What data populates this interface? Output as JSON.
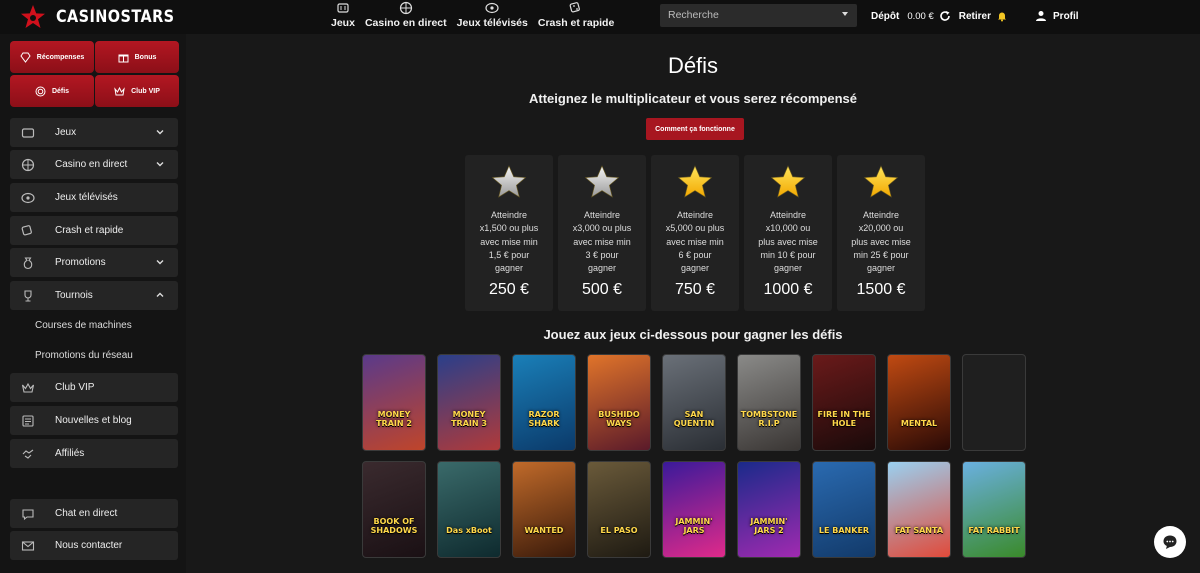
{
  "brand": {
    "name": "CASINOSTARS"
  },
  "topnav": [
    {
      "label": "Jeux",
      "icon": "slot-machine-icon"
    },
    {
      "label": "Casino en direct",
      "icon": "roulette-icon"
    },
    {
      "label": "Jeux télévisés",
      "icon": "tv-wheel-icon"
    },
    {
      "label": "Crash et rapide",
      "icon": "dice-icon"
    }
  ],
  "search": {
    "placeholder": "Recherche"
  },
  "account": {
    "deposit_label": "Dépôt",
    "balance": "0.00 €",
    "withdraw_label": "Retirer",
    "profile_label": "Profil"
  },
  "sidebar": {
    "promo_buttons": [
      {
        "label": "Récompenses",
        "icon": "diamond-icon"
      },
      {
        "label": "Bonus",
        "icon": "gift-icon"
      },
      {
        "label": "Défis",
        "icon": "target-icon"
      },
      {
        "label": "Club VIP",
        "icon": "crown-icon"
      }
    ],
    "items": [
      {
        "label": "Jeux",
        "icon": "slot-machine-icon",
        "expand": "down"
      },
      {
        "label": "Casino en direct",
        "icon": "roulette-icon",
        "expand": "down"
      },
      {
        "label": "Jeux télévisés",
        "icon": "tv-wheel-icon"
      },
      {
        "label": "Crash et rapide",
        "icon": "dice-icon"
      },
      {
        "label": "Promotions",
        "icon": "money-bag-icon",
        "expand": "down"
      },
      {
        "label": "Tournois",
        "icon": "trophy-icon",
        "expand": "up"
      }
    ],
    "sub_items": [
      "Courses de machines",
      "Promotions du réseau"
    ],
    "items2": [
      {
        "label": "Club VIP",
        "icon": "crown-icon"
      },
      {
        "label": "Nouvelles et blog",
        "icon": "newspaper-icon"
      },
      {
        "label": "Affiliés",
        "icon": "handshake-icon"
      }
    ],
    "support": [
      {
        "label": "Chat en direct",
        "icon": "chat-bubble-icon"
      },
      {
        "label": "Nous contacter",
        "icon": "envelope-icon"
      }
    ]
  },
  "page": {
    "title": "Défis",
    "subtitle": "Atteignez le multiplicateur et vous serez récompensé",
    "how_button": "Comment ça fonctionne",
    "games_title": "Jouez aux jeux ci-dessous pour gagner les défis"
  },
  "challenges": [
    {
      "star": "silver",
      "lines": [
        "Atteindre",
        "x1,500 ou plus",
        "avec mise min",
        "1,5 € pour",
        "gagner"
      ],
      "reward": "250 €"
    },
    {
      "star": "silver",
      "lines": [
        "Atteindre",
        "x3,000 ou plus",
        "avec mise min",
        "3 € pour",
        "gagner"
      ],
      "reward": "500 €"
    },
    {
      "star": "gold",
      "lines": [
        "Atteindre",
        "x5,000 ou plus",
        "avec mise min",
        "6 € pour",
        "gagner"
      ],
      "reward": "750 €"
    },
    {
      "star": "gold",
      "lines": [
        "Atteindre",
        "x10,000 ou",
        "plus avec mise",
        "min 10 € pour",
        "gagner"
      ],
      "reward": "1000 €"
    },
    {
      "star": "gold",
      "lines": [
        "Atteindre",
        "x20,000 ou",
        "plus avec mise",
        "min 25 € pour",
        "gagner"
      ],
      "reward": "1500 €"
    }
  ],
  "games": [
    {
      "name": "MONEY TRAIN 2",
      "colors": [
        "#5a3a8a",
        "#c0452a"
      ]
    },
    {
      "name": "MONEY TRAIN 3",
      "colors": [
        "#2a3f8a",
        "#b03a3a"
      ]
    },
    {
      "name": "RAZOR SHARK",
      "colors": [
        "#1a7fb8",
        "#0b3a6a"
      ]
    },
    {
      "name": "BUSHIDO WAYS",
      "colors": [
        "#e0742a",
        "#5a1a2a"
      ]
    },
    {
      "name": "SAN QUENTIN",
      "colors": [
        "#6a7078",
        "#2a2e34"
      ]
    },
    {
      "name": "TOMBSTONE R.I.P",
      "colors": [
        "#8a8a88",
        "#3a3634"
      ]
    },
    {
      "name": "FIRE IN THE HOLE",
      "colors": [
        "#6a1a1a",
        "#1a0a0a"
      ]
    },
    {
      "name": "MENTAL",
      "colors": [
        "#c04a12",
        "#2a0a06"
      ]
    },
    {
      "name": "",
      "colors": [
        "#1f1f1f",
        "#1f1f1f"
      ]
    },
    {
      "name": "BOOK OF SHADOWS",
      "colors": [
        "#3a2a2e",
        "#1a1014"
      ]
    },
    {
      "name": "Das xBoot",
      "colors": [
        "#3a6a6a",
        "#0e2a2e"
      ]
    },
    {
      "name": "WANTED",
      "colors": [
        "#c06a2a",
        "#3a1a0a"
      ]
    },
    {
      "name": "EL PASO",
      "colors": [
        "#6a5a3a",
        "#1e1a12"
      ]
    },
    {
      "name": "JAMMIN' JARS",
      "colors": [
        "#3a1a9a",
        "#e02a8a"
      ]
    },
    {
      "name": "JAMMIN' JARS 2",
      "colors": [
        "#1a2a8a",
        "#a02ab0"
      ]
    },
    {
      "name": "LE BANKER",
      "colors": [
        "#2a6ab0",
        "#123a6a"
      ]
    },
    {
      "name": "FAT SANTA",
      "colors": [
        "#9ad0f0",
        "#e04a3a"
      ]
    },
    {
      "name": "FAT RABBIT",
      "colors": [
        "#6ab0e0",
        "#3a8a2a"
      ]
    }
  ]
}
